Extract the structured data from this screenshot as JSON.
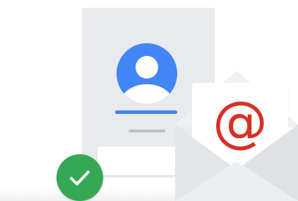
{
  "illustration": {
    "glyph_at": "@",
    "icons": {
      "avatar": "account-circle-icon",
      "check": "check-circle-icon",
      "envelope": "mail-envelope-icon"
    },
    "colors": {
      "card": "#e8eaed",
      "avatar_blue": "#4285f4",
      "name_bar_blue": "#4285f4",
      "check_green": "#34a853",
      "at_red": "#d93025",
      "envelope": "#eceff1"
    }
  }
}
